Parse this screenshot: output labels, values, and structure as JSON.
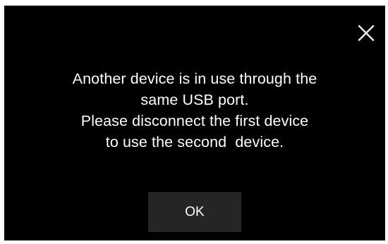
{
  "dialog": {
    "message_lines": [
      "Another device is in use through the",
      "same USB port.",
      "Please disconnect the first device",
      "to use the second  device."
    ],
    "ok_label": "OK",
    "close_icon": "close-icon"
  },
  "colors": {
    "background": "#000000",
    "text": "#ffffff",
    "button": "#252525"
  }
}
